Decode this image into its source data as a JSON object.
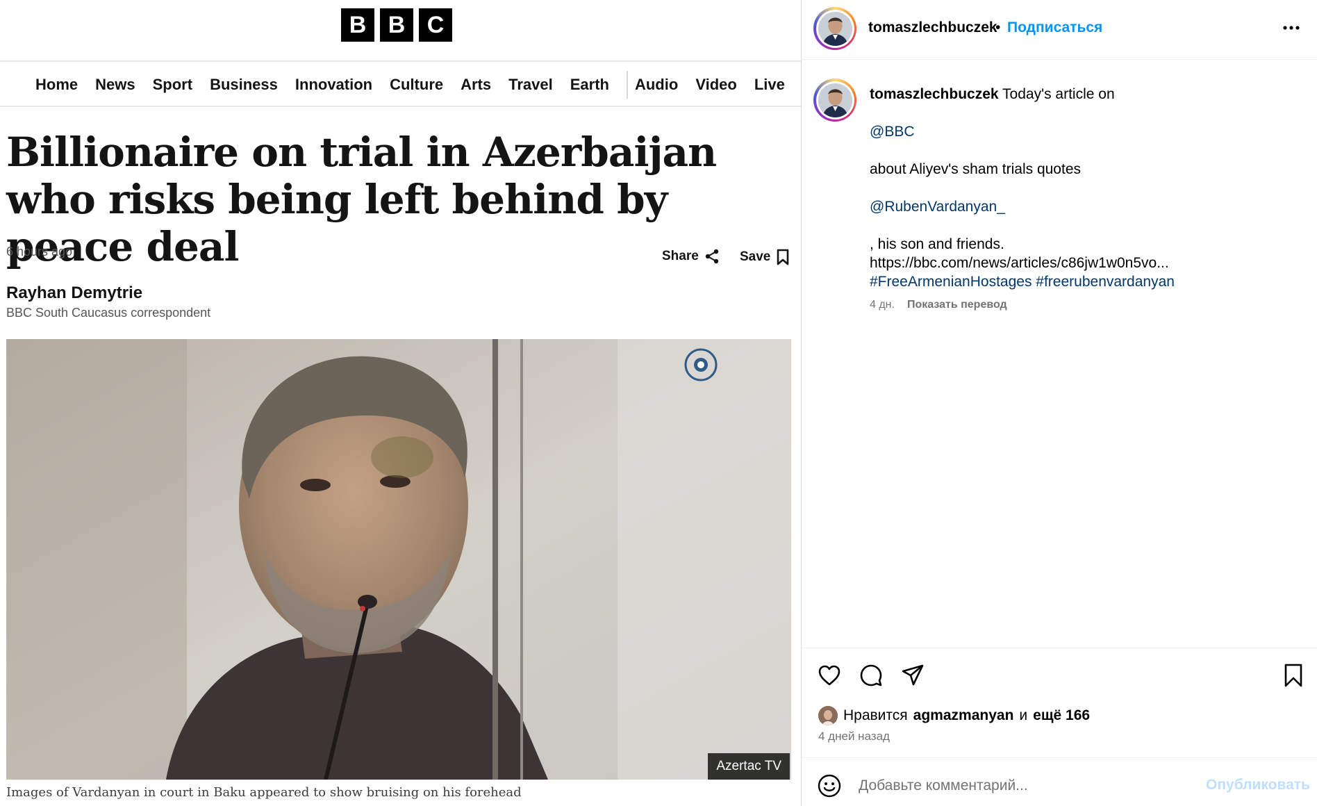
{
  "article": {
    "logo_letters": [
      "B",
      "B",
      "C"
    ],
    "nav": [
      "Home",
      "News",
      "Sport",
      "Business",
      "Innovation",
      "Culture",
      "Arts",
      "Travel",
      "Earth",
      "Audio",
      "Video",
      "Live"
    ],
    "headline": "Billionaire on trial in Azerbaijan who risks being left behind by peace deal",
    "timestamp": "6 hours ago",
    "share_label": "Share",
    "save_label": "Save",
    "author": "Rayhan Demytrie",
    "author_role": "BBC South Caucasus correspondent",
    "image_watermark": "Azertac TV",
    "image_caption": "Images of Vardanyan in court in Baku appeared to show bruising on his forehead"
  },
  "post": {
    "username": "tomaszlechbuczek",
    "separator": "•",
    "follow_label": "Подписаться",
    "more_icon": "more-horizontal-icon",
    "caption": {
      "username": "tomaszlechbuczek",
      "intro": "Today's article on",
      "mention1": "@BBC",
      "line2": "about Aliyev's sham trials quotes",
      "mention2": "@RubenVardanyan_",
      "line3": ", his son and friends.",
      "url": "https://bbc.com/news/articles/c86jw1w0n5vo...",
      "hashtag1": "#FreeArmenianHostages",
      "hashtag2": "#freerubenvardanyan"
    },
    "caption_age": "4 дн.",
    "translate_label": "Показать перевод",
    "likes_prefix": "Нравится",
    "likes_user": "agmazmanyan",
    "likes_conj": "и",
    "likes_rest": "ещё 166",
    "time_ago": "4 дней назад",
    "comment_placeholder": "Добавьте комментарий...",
    "publish_label": "Опубликовать"
  },
  "colors": {
    "link_blue": "#00376b",
    "follow_blue": "#0095f6",
    "publish_disabled": "#c0dffd"
  }
}
